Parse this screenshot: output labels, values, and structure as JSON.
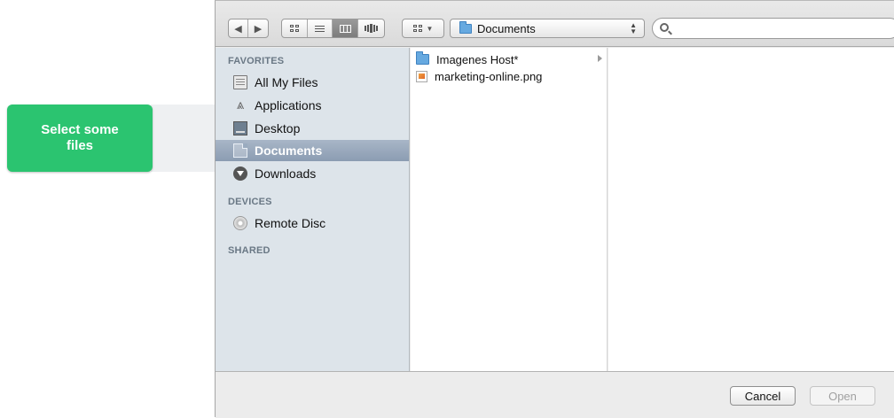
{
  "callout": {
    "text": "Select some files",
    "color": "#2bc470"
  },
  "toolbar": {
    "nav": [
      "back-icon",
      "forward-icon"
    ],
    "view_modes": [
      "icon-view-icon",
      "list-view-icon",
      "column-view-icon",
      "coverflow-view-icon"
    ],
    "active_view": "column-view-icon",
    "arrange_icon": "arrange-icon",
    "path_popup": {
      "label": "Documents",
      "icon": "folder-icon"
    },
    "search": {
      "value": "",
      "placeholder": ""
    }
  },
  "sidebar": {
    "sections": [
      {
        "title": "FAVORITES",
        "items": [
          {
            "label": "All My Files",
            "icon": "all-files-icon"
          },
          {
            "label": "Applications",
            "icon": "applications-icon"
          },
          {
            "label": "Desktop",
            "icon": "desktop-icon"
          },
          {
            "label": "Documents",
            "icon": "documents-icon",
            "selected": true
          },
          {
            "label": "Downloads",
            "icon": "downloads-icon"
          }
        ]
      },
      {
        "title": "DEVICES",
        "items": [
          {
            "label": "Remote Disc",
            "icon": "disc-icon"
          }
        ]
      },
      {
        "title": "SHARED",
        "items": []
      }
    ],
    "selected_color": "#8b9cb2"
  },
  "files": [
    {
      "name": "Imagenes Host*",
      "icon": "folder-icon",
      "has_children": true
    },
    {
      "name": "marketing-online.png",
      "icon": "png-file-icon",
      "has_children": false
    }
  ],
  "footer": {
    "cancel_label": "Cancel",
    "open_label": "Open"
  }
}
